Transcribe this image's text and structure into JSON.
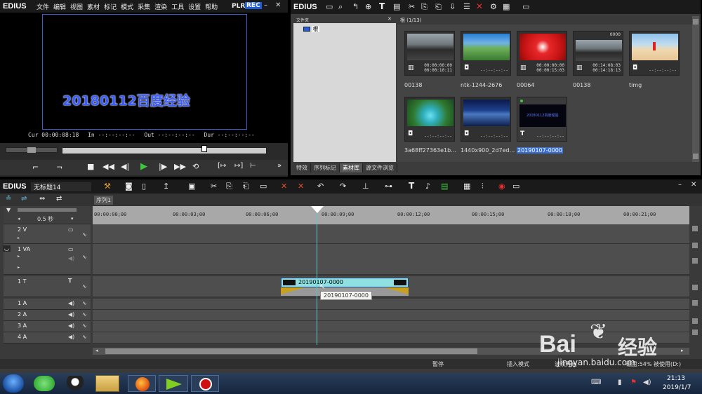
{
  "player": {
    "app_name": "EDIUS",
    "menu": [
      "文件",
      "编辑",
      "视图",
      "素材",
      "标记",
      "模式",
      "采集",
      "渲染",
      "工具",
      "设置",
      "帮助"
    ],
    "plr_label": "PLR",
    "rec_label": "REC",
    "preview_text": "20180112百度经验",
    "cur_label": "Cur",
    "cur_value": "00:00:08:18",
    "in_label": "In",
    "in_value": "--:--:--:--",
    "out_label": "Out",
    "out_value": "--:--:--:--",
    "dur_label": "Dur",
    "dur_value": "--:--:--:--"
  },
  "bin": {
    "app_name": "EDIUS",
    "folder_header": "文件夹",
    "root_label": "根",
    "path_label": "根 (1/13)",
    "clips": [
      {
        "name": "00138",
        "tc1": "00:00:00:00",
        "tc2": "00:00:10:11",
        "type": "video",
        "badge": ""
      },
      {
        "name": "ntk-1244-2676",
        "tc1": "--:--:--:--",
        "tc2": "",
        "type": "image",
        "badge": ""
      },
      {
        "name": "00064",
        "tc1": "00:00:00:00",
        "tc2": "00:00:15:03",
        "type": "video",
        "badge": ""
      },
      {
        "name": "00138",
        "tc1": "00:14:08:03",
        "tc2": "00:14:18:13",
        "type": "video",
        "badge": "0000"
      },
      {
        "name": "timg",
        "tc1": "--:--:--:--",
        "tc2": "",
        "type": "image",
        "badge": ""
      },
      {
        "name": "3a68ff27363e1b...",
        "tc1": "--:--:--:--",
        "tc2": "",
        "type": "image",
        "badge": ""
      },
      {
        "name": "1440x900_2d7ed...",
        "tc1": "--:--:--:--",
        "tc2": "",
        "type": "image",
        "badge": ""
      },
      {
        "name": "20190107-0000",
        "tc1": "--:--:--:--",
        "tc2": "",
        "type": "title",
        "badge": ""
      }
    ],
    "title_thumb_text": "20180112百度经验",
    "tabs": [
      "特效",
      "序列标记",
      "素材库",
      "源文件浏览"
    ],
    "active_tab": "素材库"
  },
  "timeline": {
    "app_name": "EDIUS",
    "project_name": "无标题14",
    "sequence_tab": "序列1",
    "scale": "0.5 秒",
    "ruler": [
      "00:00:00;00",
      "00:00:03;00",
      "00:00:06;00",
      "00:00:09;00",
      "00:00:12;00",
      "00:00:15;00",
      "00:00:18;00",
      "00:00:21;00"
    ],
    "tracks": [
      "2 V",
      "1 VA",
      "1 T",
      "1 A",
      "2 A",
      "3 A",
      "4 A"
    ],
    "clip_label": "20190107-0000",
    "tooltip": "20190107-0000",
    "status": {
      "pause": "暂停",
      "insert_mode": "插入模式",
      "waveform": "波纹开启",
      "disk": "磁盘:54% 被使用(D:)"
    }
  },
  "taskbar": {
    "time": "21:13",
    "date": "2019/1/7"
  },
  "watermark": {
    "brand": "Bai",
    "brand_cn": "经验",
    "url": "jingyan.baidu.com"
  },
  "colors": {
    "rec_badge": "#1e5bd6",
    "preview_border": "#3a5bd6",
    "title_text": "#3b5dff",
    "clip_fill": "#8fe0e0",
    "timeline_playhead": "#5bc8c8",
    "selected_label": "#3a6fd0"
  }
}
